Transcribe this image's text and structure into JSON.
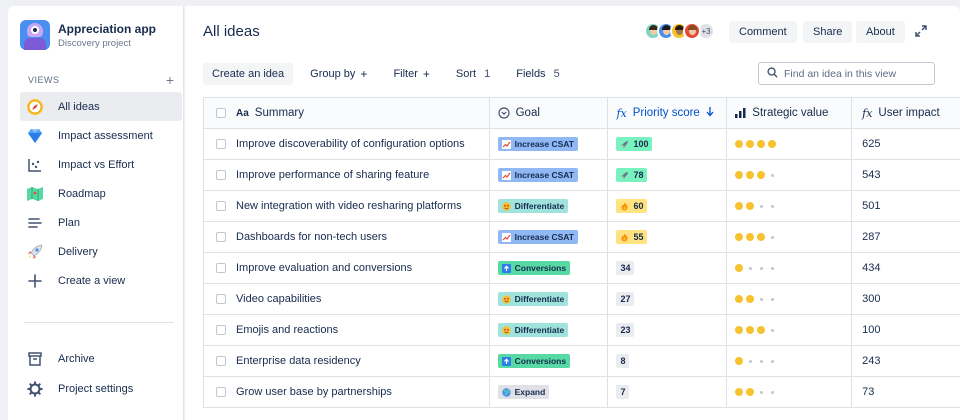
{
  "app": {
    "title": "Appreciation app",
    "subtitle": "Discovery project"
  },
  "sidebar": {
    "views_label": "VIEWS",
    "add_view_symbol": "+",
    "items": [
      {
        "label": "All ideas",
        "icon": "compass-icon",
        "active": true
      },
      {
        "label": "Impact assessment",
        "icon": "diamond-icon"
      },
      {
        "label": "Impact vs Effort",
        "icon": "scatter-chart-icon"
      },
      {
        "label": "Roadmap",
        "icon": "map-icon"
      },
      {
        "label": "Plan",
        "icon": "list-icon"
      },
      {
        "label": "Delivery",
        "icon": "rocket-icon"
      },
      {
        "label": "Create a view",
        "icon": "plus-icon"
      }
    ],
    "bottom_items": [
      {
        "label": "Archive",
        "icon": "archive-icon"
      },
      {
        "label": "Project settings",
        "icon": "gear-icon"
      }
    ]
  },
  "header": {
    "title": "All ideas",
    "avatars_more": "+3",
    "comment_label": "Comment",
    "share_label": "Share",
    "about_label": "About"
  },
  "toolbar": {
    "create_label": "Create an idea",
    "group_label": "Group by",
    "group_plus": "+",
    "filter_label": "Filter",
    "filter_plus": "+",
    "sort_label": "Sort",
    "sort_count": "1",
    "fields_label": "Fields",
    "fields_count": "5",
    "search_placeholder": "Find an idea in this view"
  },
  "table": {
    "columns": {
      "summary": "Summary",
      "summary_prefix": "Aa",
      "goal": "Goal",
      "priority": "Priority score",
      "strategic": "Strategic value",
      "user_impact": "User impact",
      "fx": "fx"
    },
    "rows": [
      {
        "summary": "Improve discoverability of configuration options",
        "goal": "Increase CSAT",
        "priority": "100",
        "strategic": 4,
        "user_impact": "625"
      },
      {
        "summary": "Improve performance of sharing feature",
        "goal": "Increase CSAT",
        "priority": "78",
        "strategic": 3,
        "user_impact": "543"
      },
      {
        "summary": "New integration with video resharing platforms",
        "goal": "Differentiate",
        "priority": "60",
        "strategic": 2,
        "user_impact": "501"
      },
      {
        "summary": "Dashboards for non-tech users",
        "goal": "Increase CSAT",
        "priority": "55",
        "strategic": 3,
        "user_impact": "287"
      },
      {
        "summary": "Improve evaluation and conversions",
        "goal": "Conversions",
        "priority": "34",
        "strategic": 1,
        "user_impact": "434"
      },
      {
        "summary": "Video capabilities",
        "goal": "Differentiate",
        "priority": "27",
        "strategic": 2,
        "user_impact": "300"
      },
      {
        "summary": "Emojis and reactions",
        "goal": "Differentiate",
        "priority": "23",
        "strategic": 3,
        "user_impact": "100"
      },
      {
        "summary": "Enterprise data residency",
        "goal": "Conversions",
        "priority": "8",
        "strategic": 1,
        "user_impact": "243"
      },
      {
        "summary": "Grow user base by partnerships",
        "goal": "Expand",
        "priority": "7",
        "strategic": 2,
        "user_impact": "73"
      }
    ]
  },
  "goal_styles": {
    "Increase CSAT": {
      "bg": "#8fb8f5",
      "icon": "chart-trend-icon"
    },
    "Differentiate": {
      "bg": "#9fe3dc",
      "icon": "star-struck-icon"
    },
    "Conversions": {
      "bg": "#57d9a3",
      "icon": "arrow-up-icon"
    },
    "Expand": {
      "bg": "#dfe1e6",
      "icon": "globe-icon"
    }
  },
  "colors": {
    "prio_rocket": "#79f2c0",
    "prio_fire": "#ffe380",
    "prio_plain": "#ebecf0",
    "star_filled": "#f6c32e",
    "accent": "#0052cc"
  }
}
